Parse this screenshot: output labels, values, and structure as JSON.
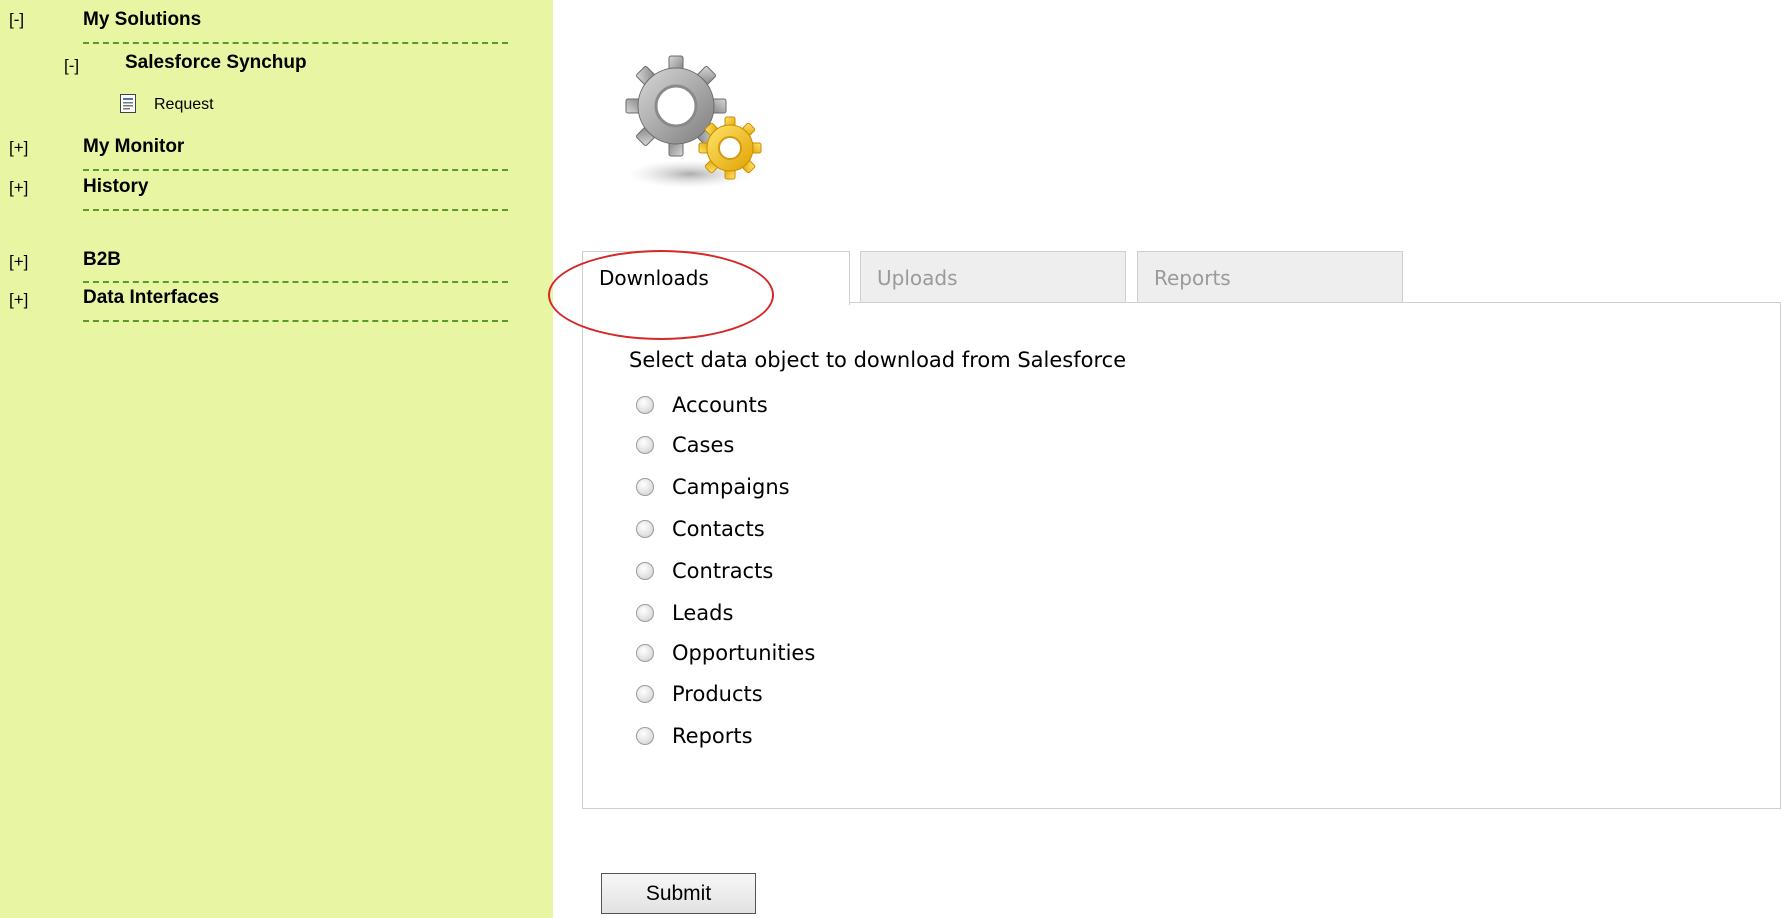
{
  "sidebar": {
    "tree": [
      {
        "toggle": "[-]",
        "label": "My Solutions"
      },
      {
        "toggle": "[-]",
        "label": "Salesforce Synchup"
      },
      {
        "label": "Request"
      },
      {
        "toggle": "[+]",
        "label": "My Monitor"
      },
      {
        "toggle": "[+]",
        "label": "History"
      },
      {
        "toggle": "[+]",
        "label": "B2B"
      },
      {
        "toggle": "[+]",
        "label": "Data Interfaces"
      }
    ]
  },
  "main": {
    "tabs": [
      {
        "label": "Downloads",
        "active": true
      },
      {
        "label": "Uploads",
        "active": false
      },
      {
        "label": "Reports",
        "active": false
      }
    ],
    "prompt": "Select data object to download from Salesforce",
    "options": [
      "Accounts",
      "Cases",
      "Campaigns",
      "Contacts",
      "Contracts",
      "Leads",
      "Opportunities",
      "Products",
      "Reports"
    ],
    "submit_label": "Submit"
  },
  "colors": {
    "sidebar_bg": "#e8f5a3",
    "dash": "#5a9a28",
    "highlight": "#d62828",
    "inactive_tab_text": "#9a9a9a"
  },
  "icons": {
    "logo": "gears-icon",
    "request": "document-icon"
  }
}
